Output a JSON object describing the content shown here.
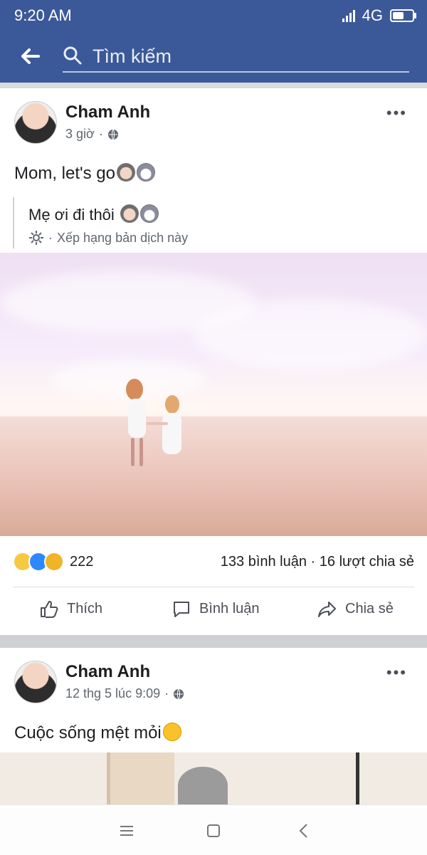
{
  "status": {
    "time": "9:20 AM",
    "network": "4G",
    "battery_fraction": 0.7
  },
  "search": {
    "placeholder": "Tìm kiếm",
    "value": "",
    "back_icon": "arrow-left-icon",
    "search_icon": "search-icon"
  },
  "posts": [
    {
      "author": "Cham Anh",
      "time": "3 giờ",
      "privacy_icon": "globe-icon",
      "text": "Mom, let's go",
      "emojis": [
        "woman-face-icon",
        "girl-face-icon"
      ],
      "translation": {
        "text": "Mẹ ơi đi thôi",
        "rate_label": "Xếp hạng bản dịch này",
        "settings_icon": "gear-icon"
      },
      "photo_alt": "mother and daughter holding hands in the sea",
      "reactions": {
        "icons": [
          "sad-reaction-icon",
          "like-reaction-icon",
          "wow-reaction-icon"
        ],
        "count": "222"
      },
      "stats": "133 bình luận · 16 lượt chia sẻ",
      "actions": [
        {
          "label": "Thích",
          "icon": "thumbs-up-icon"
        },
        {
          "label": "Bình luận",
          "icon": "comment-icon"
        },
        {
          "label": "Chia sẻ",
          "icon": "share-icon"
        }
      ]
    },
    {
      "author": "Cham Anh",
      "time": "12 thg 5 lúc 9:09",
      "privacy_icon": "globe-icon",
      "text": "Cuộc sống mệt mỏi",
      "emojis": [
        "sleepy-face-icon"
      ]
    }
  ],
  "navbar": {
    "icons": [
      "menu-icon",
      "home-square-icon",
      "back-chevron-icon"
    ]
  },
  "colors": {
    "facebook_blue": "#3b5998",
    "text": "#1c1e21",
    "secondary_text": "#606770"
  }
}
